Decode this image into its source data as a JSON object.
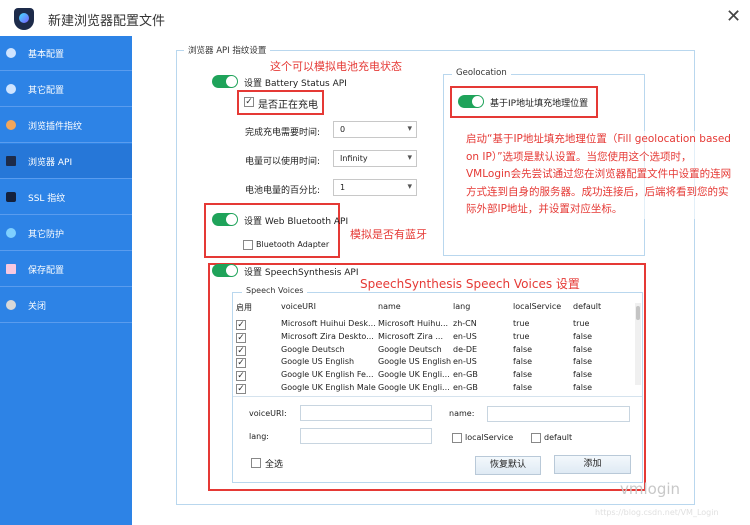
{
  "window": {
    "title": "新建浏览器配置文件",
    "close": "✕"
  },
  "sidebar": {
    "items": [
      {
        "label": "基本配置"
      },
      {
        "label": "其它配置"
      },
      {
        "label": "浏览插件指纹"
      },
      {
        "label": "浏览器 API"
      },
      {
        "label": "SSL 指纹"
      },
      {
        "label": "其它防护"
      },
      {
        "label": "保存配置"
      },
      {
        "label": "关闭"
      }
    ]
  },
  "main": {
    "group_title": "浏览器 API 指纹设置",
    "battery": {
      "toggle_label": "设置 Battery Status API",
      "enabled": true,
      "charging_label": "是否正在充电",
      "charging": true,
      "rows": [
        {
          "label": "完成充电需要时间:",
          "value": "0"
        },
        {
          "label": "电量可以使用时间:",
          "value": "Infinity"
        },
        {
          "label": "电池电量的百分比:",
          "value": "1"
        }
      ]
    },
    "bluetooth": {
      "toggle_label": "设置 Web Bluetooth API",
      "enabled": true,
      "adapter_label": "Bluetooth Adapter",
      "adapter": false
    },
    "geolocation": {
      "group_title": "Geolocation",
      "toggle_label": "基于IP地址填充地理位置",
      "enabled": true
    },
    "speech": {
      "toggle_label": "设置 SpeechSynthesis API",
      "enabled": true,
      "group_title": "Speech Voices",
      "columns": [
        "启用",
        "voiceURI",
        "name",
        "lang",
        "localService",
        "default"
      ],
      "rows": [
        [
          "Microsoft Huihui Desk...",
          "Microsoft Huihu...",
          "zh-CN",
          "true",
          "true"
        ],
        [
          "Microsoft Zira Deskto...",
          "Microsoft Zira ...",
          "en-US",
          "true",
          "false"
        ],
        [
          "Google Deutsch",
          "Google Deutsch",
          "de-DE",
          "false",
          "false"
        ],
        [
          "Google US English",
          "Google US English",
          "en-US",
          "false",
          "false"
        ],
        [
          "Google UK English Fe...",
          "Google UK Engli...",
          "en-GB",
          "false",
          "false"
        ],
        [
          "Google UK English Male",
          "Google UK Engli...",
          "en-GB",
          "false",
          "false"
        ]
      ],
      "form": {
        "voiceuri_label": "voiceURI:",
        "name_label": "name:",
        "lang_label": "lang:",
        "localservice_label": "localService",
        "default_label": "default",
        "select_all_label": "全选",
        "reset_button": "恢复默认",
        "add_button": "添加"
      }
    }
  },
  "annotations": {
    "battery": "这个可以模拟电池充电状态",
    "bluetooth": "模拟是否有蓝牙",
    "speech": "SpeechSynthesis Speech Voices 设置",
    "geolocation": "启动“基于IP地址填充地理位置（Fill geolocation based on IP）”选项是默认设置。当您使用这个选项时，VMLogin会先尝试通过您在浏览器配置文件中设置的连网方式连到自身的服务器。成功连接后，后端将看到您的实际外部IP地址，并设置对应坐标。"
  },
  "watermark": {
    "brand": "vmlogin",
    "url": "https://blog.csdn.net/VM_Login"
  }
}
